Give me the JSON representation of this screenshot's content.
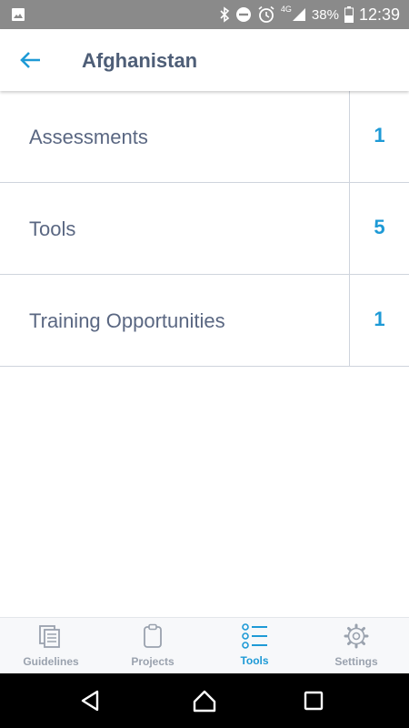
{
  "status_bar": {
    "network": "4G",
    "battery": "38%",
    "time": "12:39"
  },
  "header": {
    "title": "Afghanistan"
  },
  "list": [
    {
      "label": "Assessments",
      "count": "1"
    },
    {
      "label": "Tools",
      "count": "5"
    },
    {
      "label": "Training Opportunities",
      "count": "1"
    }
  ],
  "tabs": [
    {
      "label": "Guidelines",
      "icon": "guidelines-icon",
      "active": false
    },
    {
      "label": "Projects",
      "icon": "clipboard-icon",
      "active": false
    },
    {
      "label": "Tools",
      "icon": "tools-list-icon",
      "active": true
    },
    {
      "label": "Settings",
      "icon": "gear-icon",
      "active": false
    }
  ],
  "colors": {
    "accent": "#1e9ad6",
    "title": "#4e5e77",
    "inactive_tab": "#9aa2ae"
  }
}
